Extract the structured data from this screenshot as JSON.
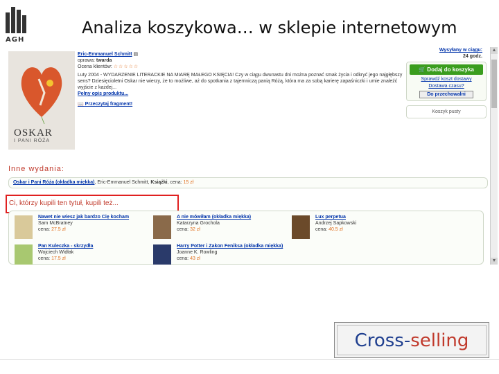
{
  "slide": {
    "logo_text": "AGH",
    "title": "Analiza koszykowa… w sklepie internetowym",
    "cross_part1": "Cross-",
    "cross_part2": "selling"
  },
  "product": {
    "cover_title": "OSKAR",
    "cover_subtitle": "I PANI RÓŻA",
    "author": "Eric-Emmanuel Schmitt",
    "binding_label": "oprawa:",
    "binding_value": "twarda",
    "rating_label": "Ocena klientów:",
    "rating_stars": "☆☆☆☆☆",
    "description": "Luty 2004 - WYDARZENIE LITERACKIE NA MIARĘ MAŁEGO KSIĘCIA! Czy w ciągu dwunastu dni można poznać smak życia i odkryć jego najgłębszy sens? Dziesięcioletni Oskar nie wierzy, że to możliwe, aż do spotkania z tajemniczą panią Różą, która ma za sobą karierę zapaśniczki i umie znaleźć wyjście z każdej...",
    "full_description_link": "Pełny opis produktu...",
    "read_fragment_link": "Przeczytaj fragment!"
  },
  "side": {
    "ship_line1": "Wysyłany w ciągu:",
    "ship_line2": "24 godz.",
    "add_to_cart": "Dodaj do koszyka",
    "check_delivery": "Sprawdź koszt dostawy",
    "gift_wrap": "Dostawa czasu?",
    "keep_button": "Do przechowalni",
    "cart_status": "Koszyk pusty"
  },
  "other_editions": {
    "heading": "Inne wydania:",
    "title": "Oskar i Pani Róża (okładka miękka)",
    "author_text": ", Eric-Emmanuel Schmitt, ",
    "category": "Książki",
    "price_label": ", cena: ",
    "price": "15 zł"
  },
  "bought_together": {
    "heading": "Ci, którzy kupili ten tytuł, kupili też...",
    "items": [
      {
        "title": "Nawet nie wiesz jak bardzo Cię kocham",
        "author": "Sam McBratney",
        "price_label": "cena:",
        "price": "27.5 zł",
        "thumb_color": "#d9c99a"
      },
      {
        "title": "A nie mówiłam (okładka miękka)",
        "author": "Katarzyna Grochola",
        "price_label": "cena:",
        "price": "32 zł",
        "thumb_color": "#8a6a4a"
      },
      {
        "title": "Lux perpetua",
        "author": "Andrzej Sapkowski",
        "price_label": "cena:",
        "price": "40.5 zł",
        "thumb_color": "#6b4a2a"
      },
      {
        "title": "Pan Kuleczka - skrzydła",
        "author": "Wojciech Widłak",
        "price_label": "cena:",
        "price": "17.5 zł",
        "thumb_color": "#a8c870"
      },
      {
        "title": "Harry Potter i Zakon Feniksa (okładka miękka)",
        "author": "Joanne K. Rowling",
        "price_label": "cena:",
        "price": "43 zł",
        "thumb_color": "#2a3a6a"
      }
    ]
  },
  "colors": {
    "accent_red": "#c0392b",
    "link_blue": "#0033aa",
    "price_orange": "#e07020",
    "cart_green": "#3a9d1e",
    "highlight_red": "#e02020"
  }
}
